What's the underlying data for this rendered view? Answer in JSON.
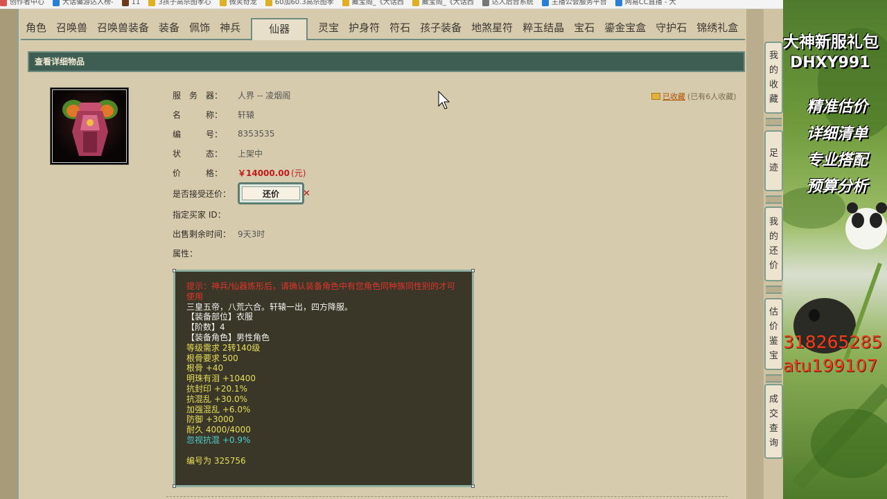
{
  "bookmarks": [
    {
      "label": "创作者中心",
      "color": "#d9534f"
    },
    {
      "label": "大话骗游达人榜-",
      "color": "#2a7fd4"
    },
    {
      "label": "11",
      "color": "#6b3a1a"
    },
    {
      "label": "3孩子高杀图孝心",
      "color": "#e0b020"
    },
    {
      "label": "微笑奇龙",
      "color": "#e0b020"
    },
    {
      "label": "60加60.3高杀图孝",
      "color": "#e0b020"
    },
    {
      "label": "藏宝阁_《大话西",
      "color": "#e0b020"
    },
    {
      "label": "藏宝阁_《大话西",
      "color": "#e0b020"
    },
    {
      "label": "达人后台系统",
      "color": "#777777"
    },
    {
      "label": "主播公会服务平台",
      "color": "#2a7fd4"
    },
    {
      "label": "网易CC直播 - 大",
      "color": "#2a7fd4"
    }
  ],
  "tabs": [
    "角色",
    "召唤兽",
    "召唤兽装备",
    "装备",
    "佩饰",
    "神兵",
    "仙器",
    "灵宝",
    "护身符",
    "符石",
    "孩子装备",
    "地煞星符",
    "粹玉结晶",
    "宝石",
    "鎏金宝盒",
    "守护石",
    "锦绣礼盒"
  ],
  "active_tab": "仙器",
  "header_title": "查看详细物品",
  "favorite": {
    "link": "已收藏",
    "count_text": "(已有6人收藏)"
  },
  "item": {
    "server_label": "服　务　器：",
    "server_value": "人界 -- 凌烟阁",
    "name_label": "名　　　称：",
    "name_value": "轩辕",
    "id_label": "编　　　号：",
    "id_value": "8353535",
    "status_label": "状　　　态：",
    "status_value": "上架中",
    "price_label": "价　　　格：",
    "price_value": "￥14000.00",
    "price_unit": "(元)",
    "haggle_label": "是否接受还价：",
    "haggle_button": "还价",
    "buyer_label": "指定买家 ID：",
    "time_label": "出售剩余时间：",
    "time_value": "9天3时",
    "attr_label": "属性："
  },
  "description": {
    "warning": "提示：神兵/仙器炼形后，请确认装备角色中有您角色同种族同性别的才可使用",
    "flavor": "三皇五帝，八荒六合。轩辕一出，四方降服。",
    "slot": "【装备部位】衣服",
    "tier": "【阶数】4",
    "role": "【装备角色】男性角色",
    "stats_yellow": [
      "等级需求 2转140级",
      "根骨要求 500",
      "根骨 +40",
      "明珠有泪 +10400",
      "抗封印 +20.1%",
      "抗混乱 +30.0%",
      "加强混乱 +6.0%",
      "防御 +3000",
      "耐久 4000/4000"
    ],
    "stat_cyan": "忽视抗混 +0.9%",
    "serial": "编号为 325756"
  },
  "side_nav": [
    {
      "label": [
        "我",
        "的",
        "收",
        "藏"
      ]
    },
    {
      "label": [
        "足",
        "迹"
      ]
    },
    {
      "label": [
        "我",
        "的",
        "还",
        "价"
      ]
    },
    {
      "label": [
        "估",
        "价",
        "鉴",
        "宝"
      ]
    },
    {
      "label": [
        "成",
        "交",
        "查",
        "询"
      ]
    }
  ],
  "ad": {
    "title": "大神新服礼包",
    "code": "DHXY991",
    "slogans": [
      "精准估价",
      "详细清单",
      "专业搭配",
      "预算分析"
    ],
    "numbers": [
      "318265285",
      "atu199107"
    ]
  }
}
